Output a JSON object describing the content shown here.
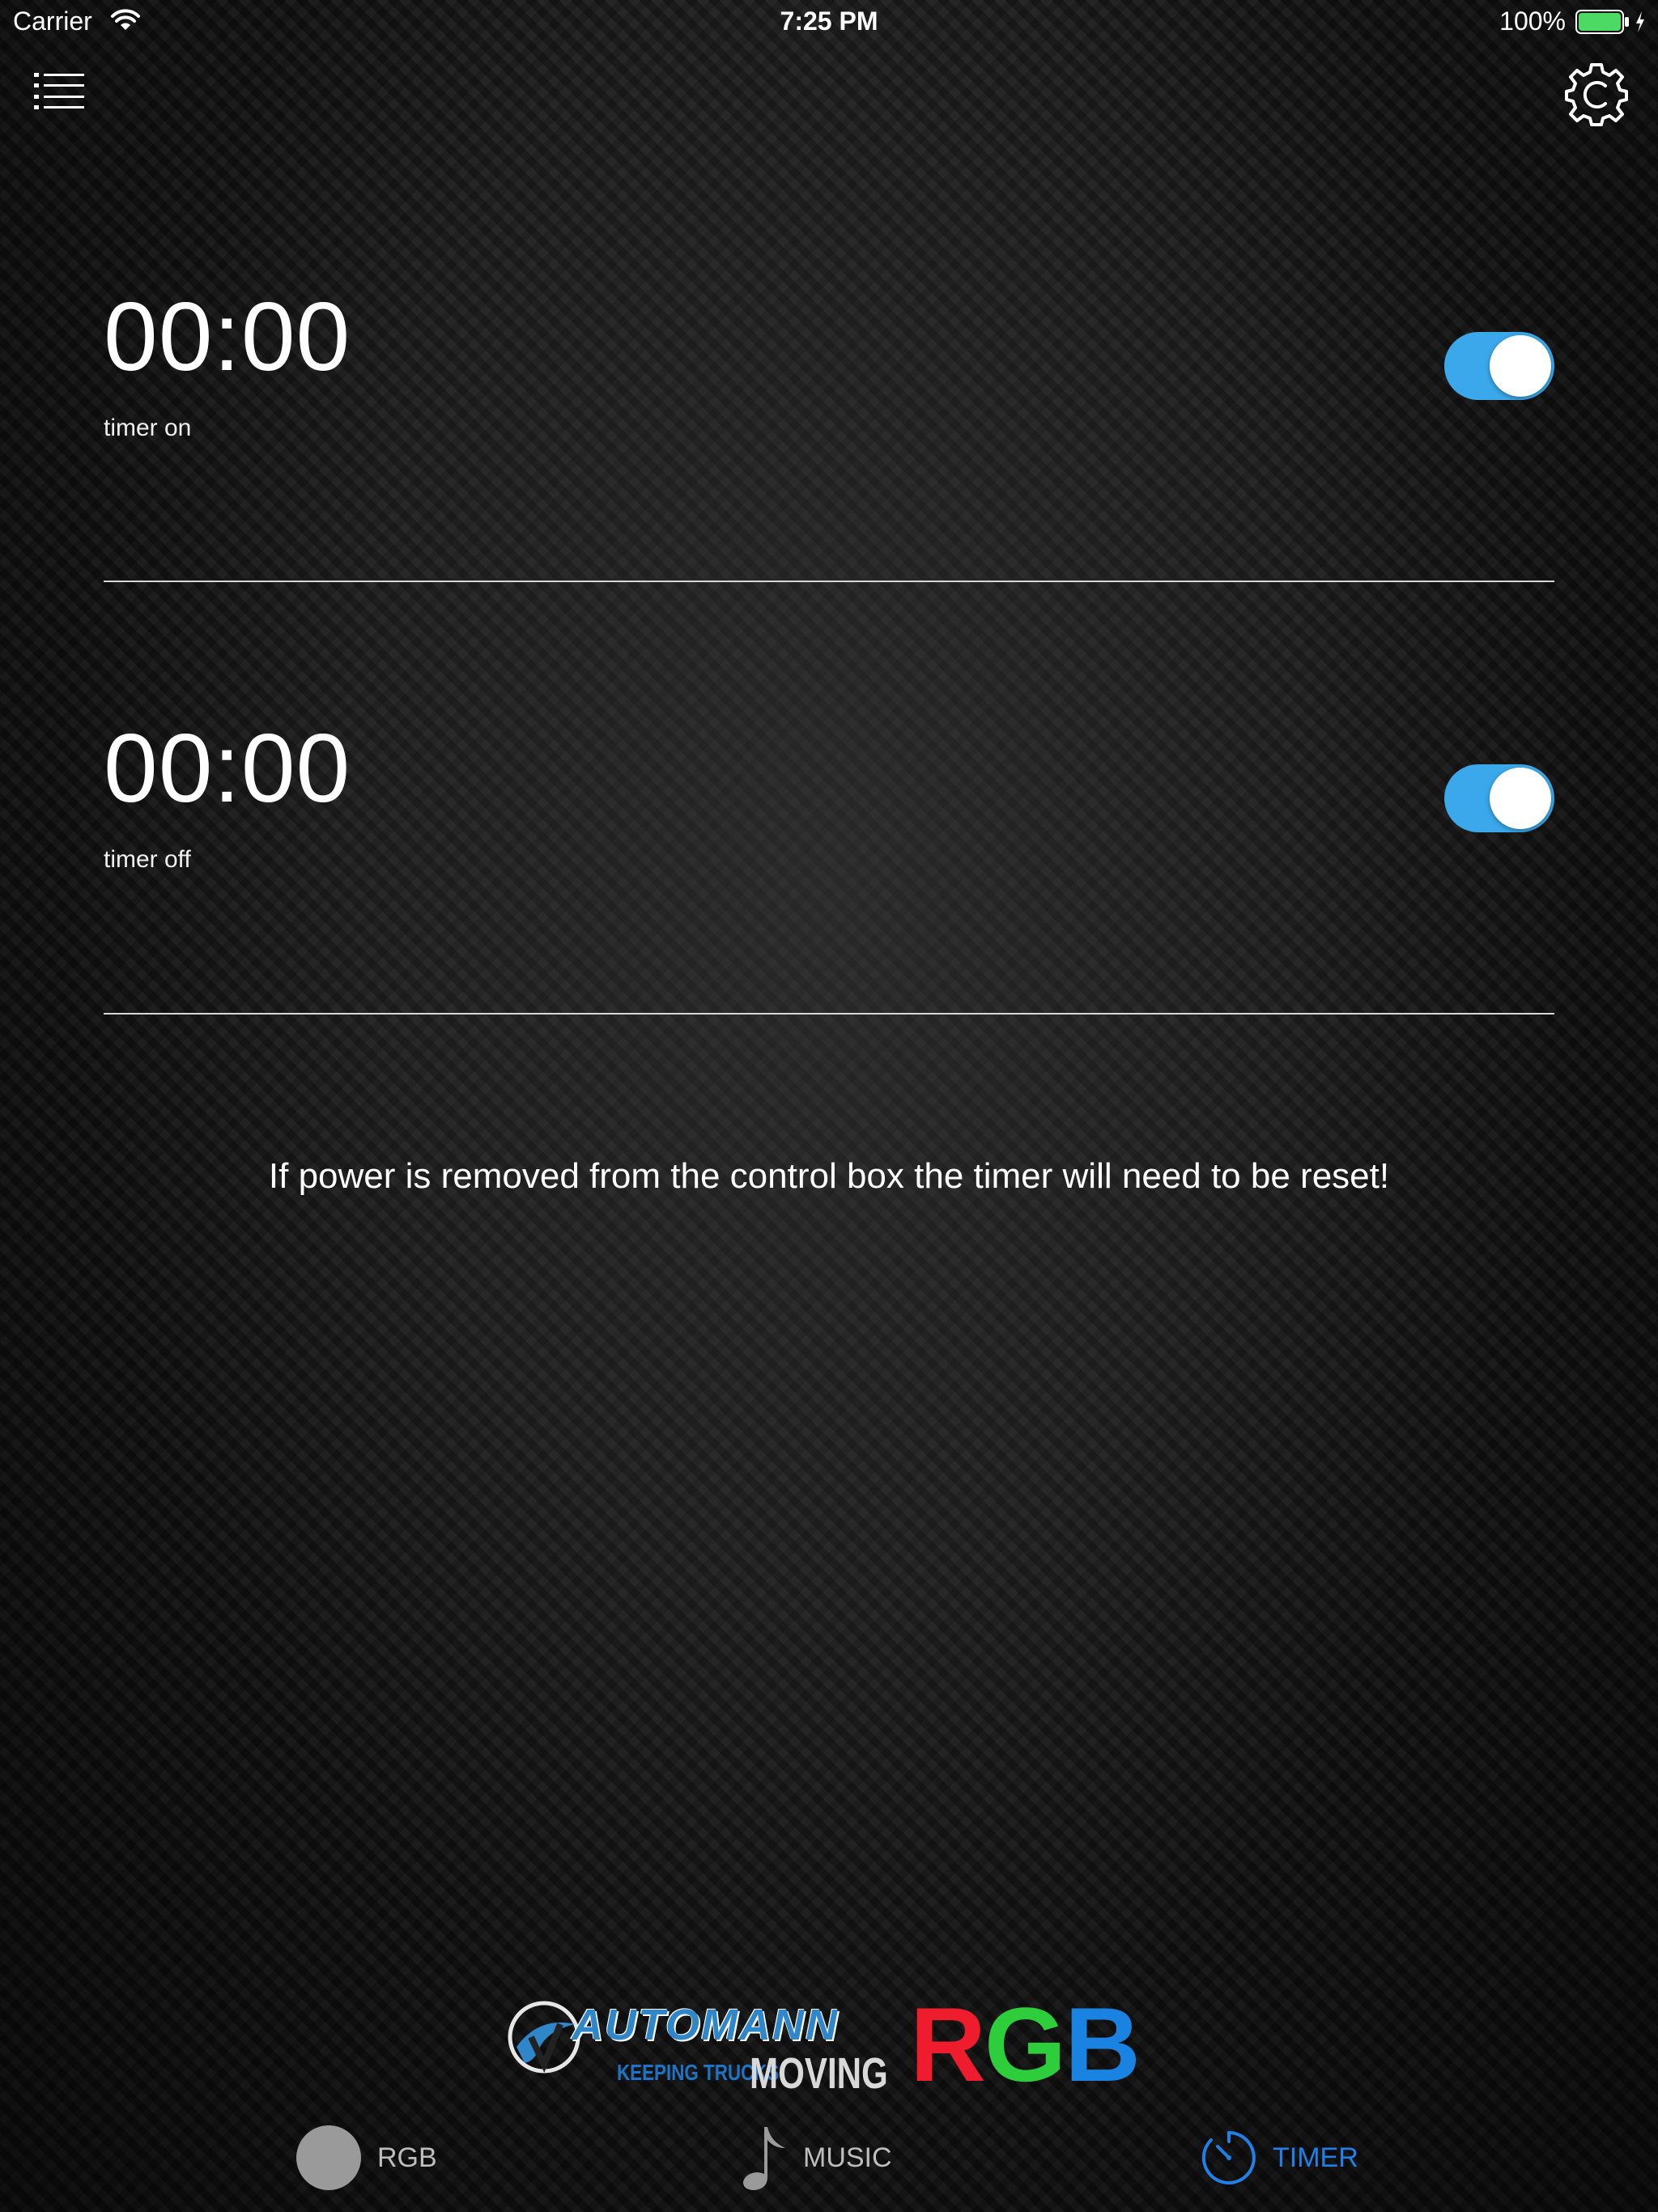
{
  "status_bar": {
    "carrier": "Carrier",
    "time": "7:25 PM",
    "battery_percent": "100%",
    "battery_level": 1.0,
    "battery_color": "#4cd964"
  },
  "nav": {
    "menu_icon": "list-icon",
    "settings_icon": "gear-icon"
  },
  "timers": [
    {
      "time": "00:00",
      "label": "timer on",
      "enabled": true
    },
    {
      "time": "00:00",
      "label": "timer off",
      "enabled": true
    }
  ],
  "warning_text": "If power is removed from the control box the timer will need to be reset!",
  "logo": {
    "brand": "AUTOMANN",
    "tagline_small": "KEEPING TRUCKS",
    "tagline_large": "MOVING",
    "rgb_r": "R",
    "rgb_g": "G",
    "rgb_b": "B"
  },
  "tabs": [
    {
      "label": "RGB",
      "icon": "circle-icon",
      "active": false
    },
    {
      "label": "MUSIC",
      "icon": "music-note-icon",
      "active": false
    },
    {
      "label": "TIMER",
      "icon": "timer-icon",
      "active": true
    }
  ],
  "colors": {
    "accent": "#1f80e8",
    "toggle_on": "#3aa8ea",
    "tab_inactive": "#bdbdbd"
  }
}
